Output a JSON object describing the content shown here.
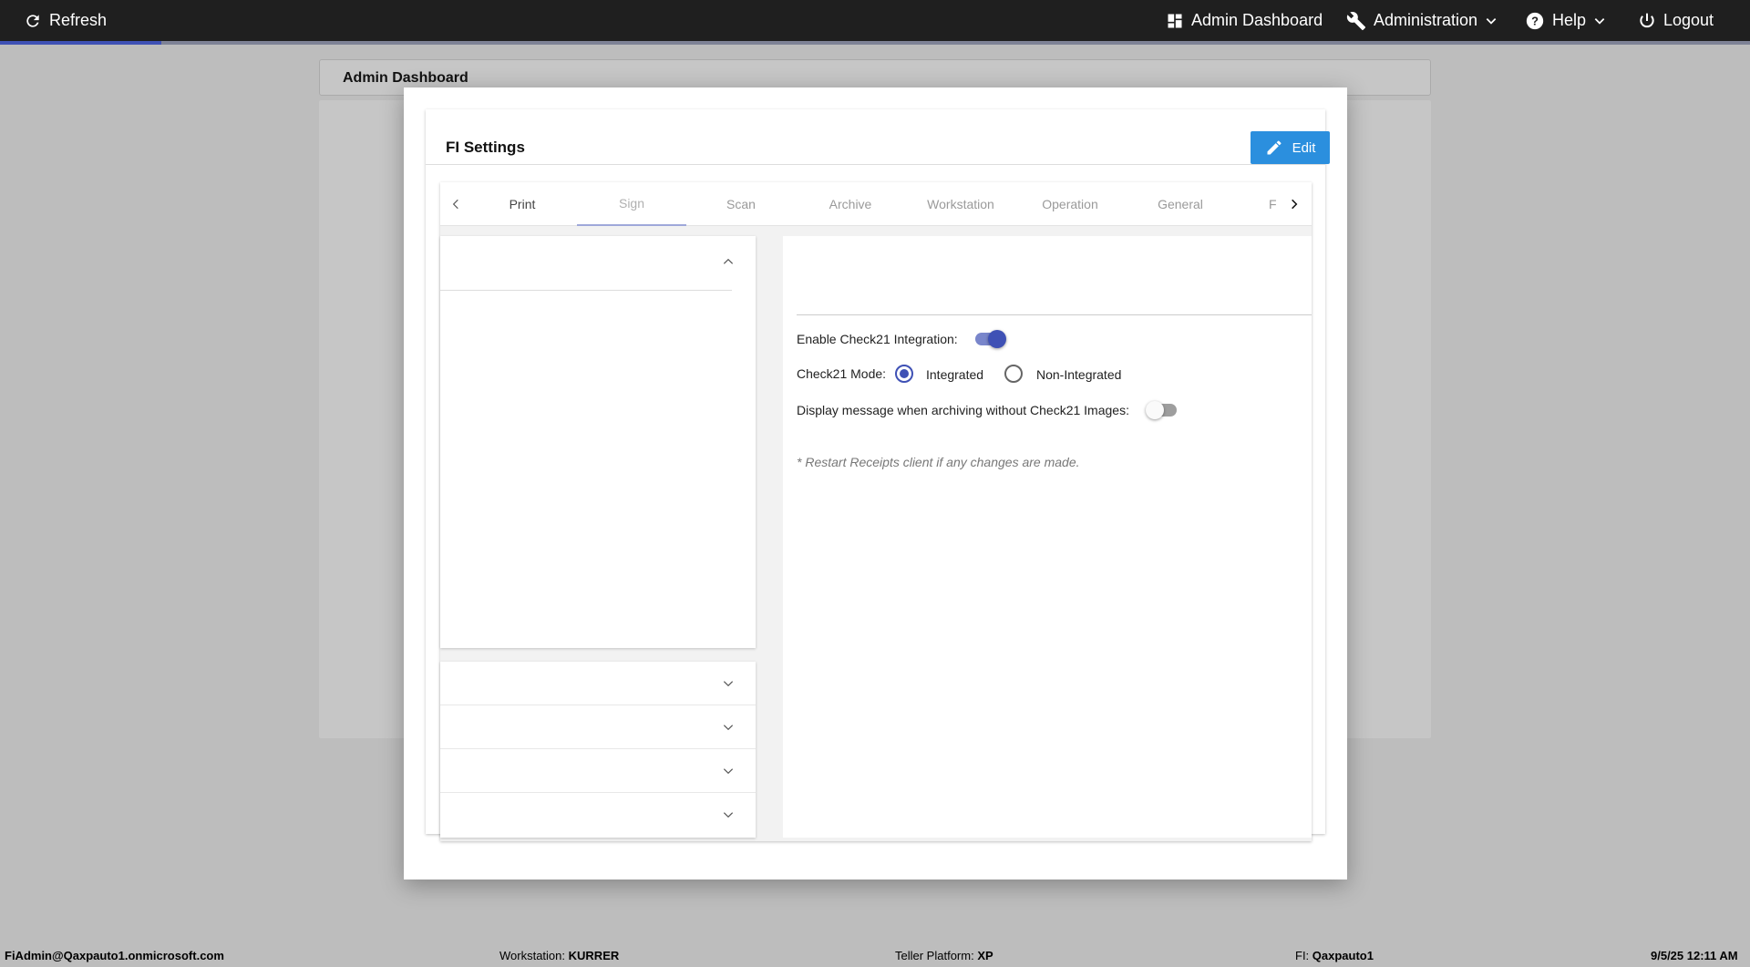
{
  "topbar": {
    "refresh_label": "Refresh",
    "admin_dashboard_label": "Admin Dashboard",
    "administration_label": "Administration",
    "help_label": "Help",
    "logout_label": "Logout",
    "progress_fraction": 0.092
  },
  "page": {
    "title": "Admin Dashboard"
  },
  "modal": {
    "title": "FI Settings",
    "edit_label": "Edit",
    "tabs": [
      {
        "label": "Print"
      },
      {
        "label": "Sign",
        "selected": true
      },
      {
        "label": "Scan"
      },
      {
        "label": "Archive"
      },
      {
        "label": "Workstation"
      },
      {
        "label": "Operation"
      },
      {
        "label": "General"
      },
      {
        "label": "F"
      }
    ],
    "settings": {
      "enable_check21_label": "Enable Check21 Integration:",
      "enable_check21_value": true,
      "check21_mode_label": "Check21 Mode:",
      "mode_options": [
        "Integrated",
        "Non-Integrated"
      ],
      "mode_selected": "Integrated",
      "display_message_label": "Display message when archiving without Check21 Images:",
      "display_message_value": false,
      "note": "* Restart Receipts client if any changes are made."
    }
  },
  "statusbar": {
    "user": "FiAdmin@Qaxpauto1.onmicrosoft.com",
    "workstation_label": "Workstation:",
    "workstation_value": "KURRER",
    "teller_platform_label": "Teller Platform:",
    "teller_platform_value": "XP",
    "fi_label": "FI:",
    "fi_value": "Qaxpauto1",
    "datetime": "9/5/25 12:11 AM"
  },
  "colors": {
    "accent": "#3f51b5",
    "edit_button": "#2b8fde",
    "topbar": "#1f1f1f"
  }
}
